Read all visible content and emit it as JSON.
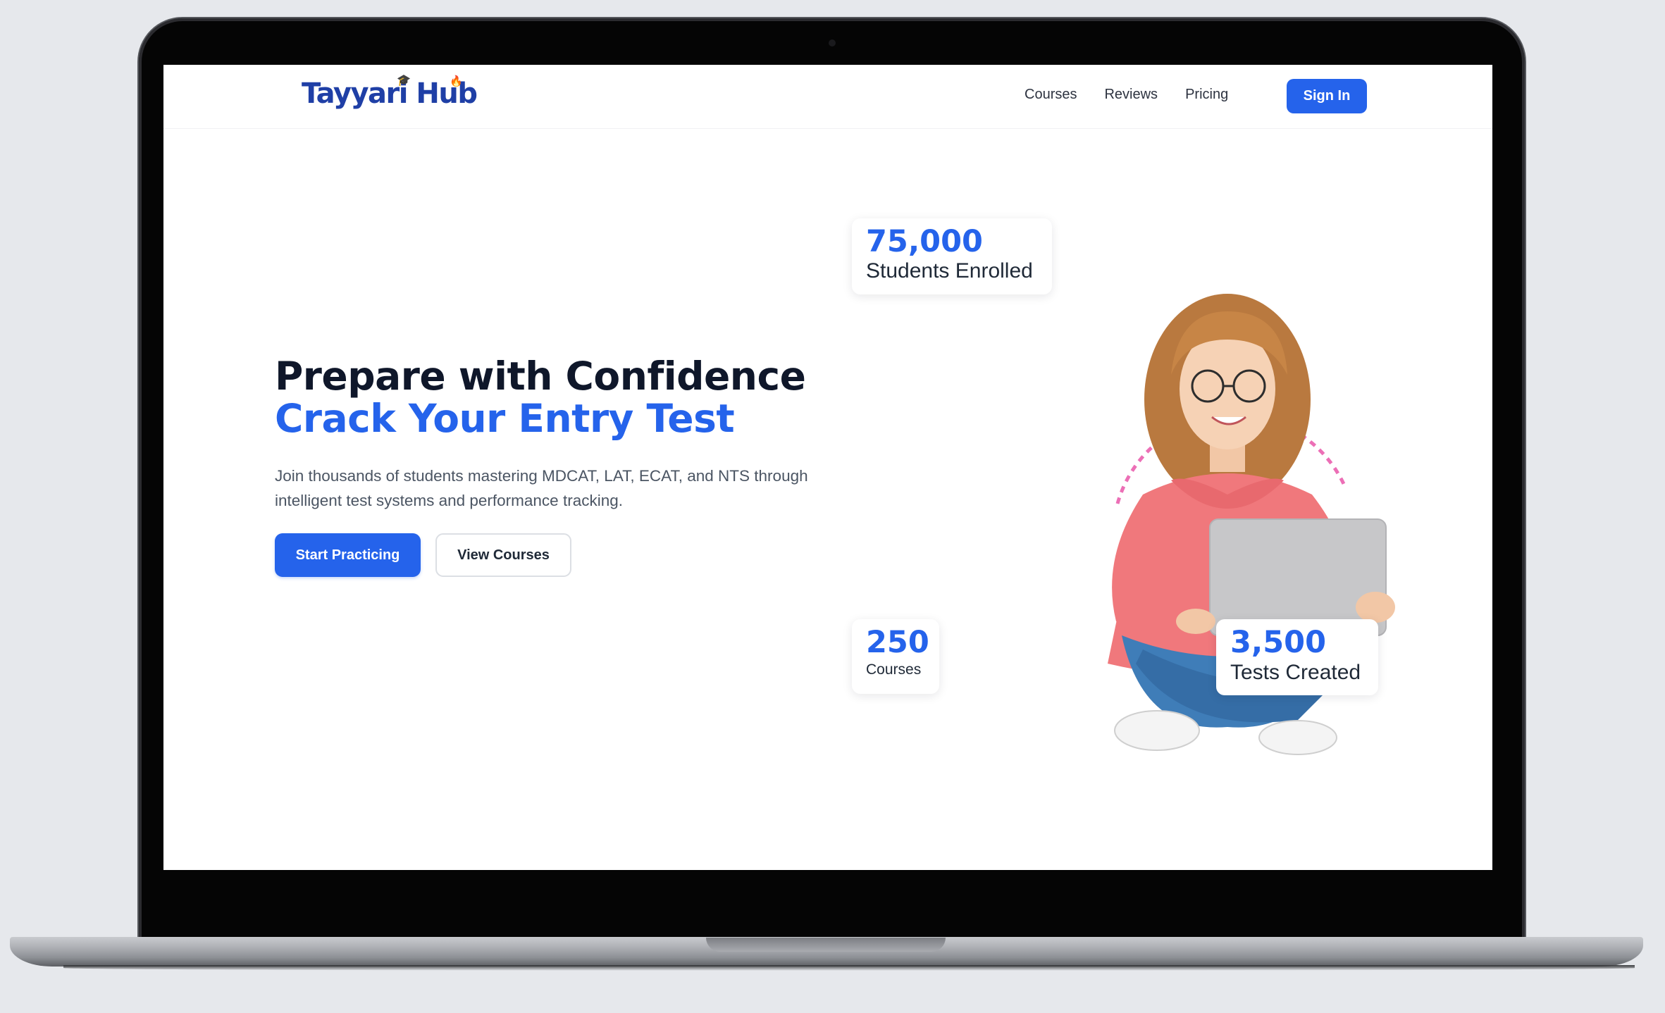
{
  "brand": {
    "name": "Tayyari Hub",
    "color": "#1f3fa6"
  },
  "nav": {
    "links": [
      {
        "label": "Courses"
      },
      {
        "label": "Reviews"
      },
      {
        "label": "Pricing"
      }
    ],
    "signin_label": "Sign In"
  },
  "hero": {
    "headline_line1": "Prepare with Confidence",
    "headline_line2": "Crack Your Entry Test",
    "subtext": "Join thousands of students mastering MDCAT, LAT, ECAT, and NTS through intelligent test systems and performance tracking.",
    "primary_cta": "Start Practicing",
    "secondary_cta": "View Courses"
  },
  "stats": {
    "students": {
      "value": "75,000",
      "label": "Students Enrolled"
    },
    "courses": {
      "value": "250",
      "label": "Courses"
    },
    "tests": {
      "value": "3,500",
      "label": "Tests Created"
    }
  },
  "colors": {
    "accent": "#2563eb",
    "heading": "#0f172a",
    "body_text": "#4b5563",
    "hoodie": "#f0787c",
    "jeans": "#3f7db8"
  },
  "icons": {
    "logo_cap": "graduation-cap-icon",
    "logo_flame": "flame-icon"
  }
}
